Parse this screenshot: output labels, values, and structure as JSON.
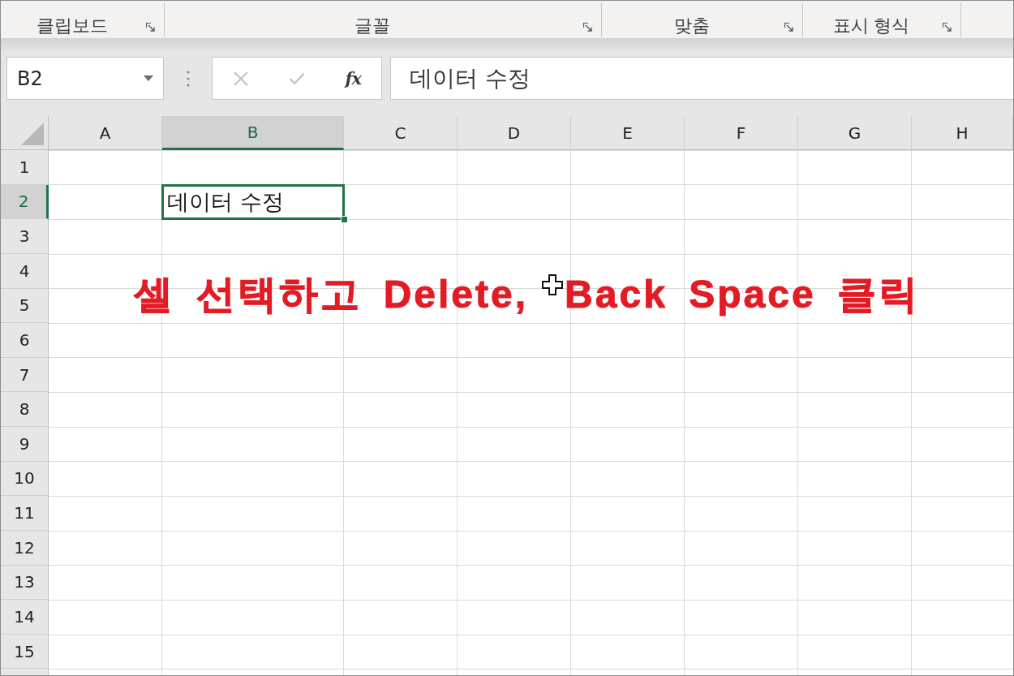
{
  "ribbon": {
    "groups": [
      {
        "label": "클립보드",
        "launcher": true
      },
      {
        "label": "글꼴",
        "launcher": true
      },
      {
        "label": "맞춤",
        "launcher": true
      },
      {
        "label": "표시 형식",
        "launcher": true
      }
    ]
  },
  "formula_bar": {
    "name_box": "B2",
    "buttons": [
      {
        "kind": "cancel",
        "disabled": true
      },
      {
        "kind": "enter",
        "disabled": true
      },
      {
        "kind": "function",
        "label": "fx",
        "disabled": false
      }
    ],
    "formula": "데이터 수정"
  },
  "sheet": {
    "columns": [
      {
        "label": "A",
        "selected": false
      },
      {
        "label": "B",
        "selected": true
      },
      {
        "label": "C",
        "selected": false
      },
      {
        "label": "D",
        "selected": false
      },
      {
        "label": "E",
        "selected": false
      },
      {
        "label": "F",
        "selected": false
      },
      {
        "label": "G",
        "selected": false
      },
      {
        "label": "H",
        "selected": false
      }
    ],
    "rows": [
      {
        "label": "1",
        "selected": false
      },
      {
        "label": "2",
        "selected": true,
        "cells": [
          null,
          {
            "value": "데이터 수정",
            "selected": true
          }
        ]
      },
      {
        "label": "3",
        "selected": false
      },
      {
        "label": "4",
        "selected": false
      },
      {
        "label": "5",
        "selected": false
      },
      {
        "label": "6",
        "selected": false
      },
      {
        "label": "7",
        "selected": false
      },
      {
        "label": "8",
        "selected": false
      },
      {
        "label": "9",
        "selected": false
      },
      {
        "label": "10",
        "selected": false
      },
      {
        "label": "11",
        "selected": false
      },
      {
        "label": "12",
        "selected": false
      },
      {
        "label": "13",
        "selected": false
      },
      {
        "label": "14",
        "selected": false
      },
      {
        "label": "15",
        "selected": false
      }
    ]
  },
  "annotation": {
    "parts": [
      "셀 선택하고 Delete,",
      "Back Space 클릭"
    ]
  }
}
